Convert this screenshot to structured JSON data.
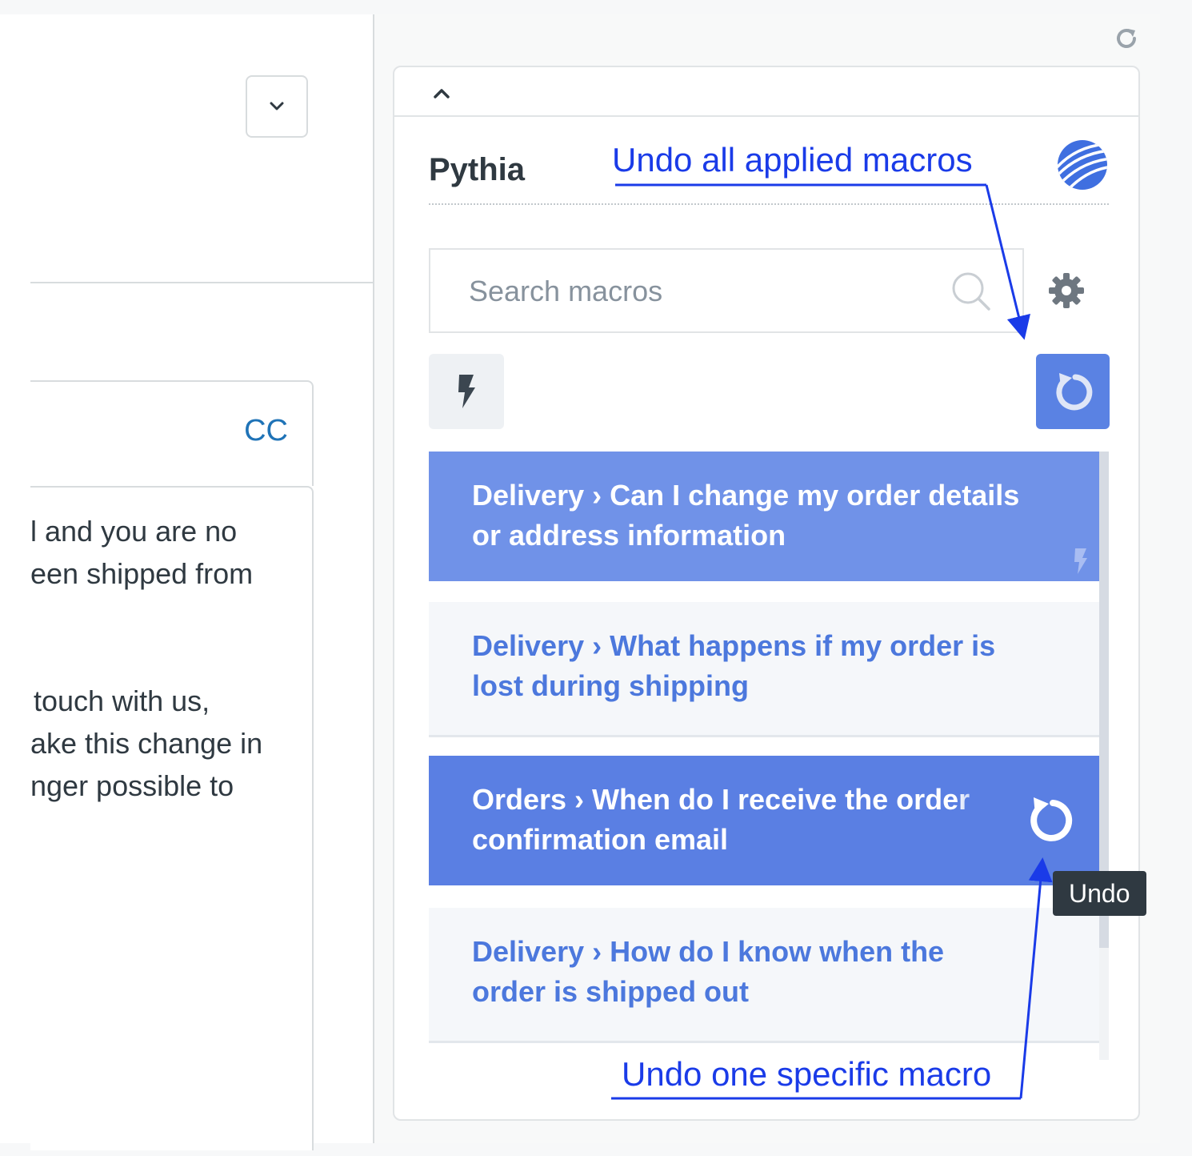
{
  "left": {
    "cc_label": "CC",
    "message_lines": [
      "l and you are no",
      "een shipped from",
      "",
      "",
      "touch with us,",
      "ake this change in",
      "nger possible to"
    ]
  },
  "panel": {
    "title": "Pythia",
    "search": {
      "placeholder": "Search macros",
      "value": ""
    },
    "macros": [
      {
        "label": "Delivery › Can I change my order details or address information",
        "state": "applied"
      },
      {
        "label": "Delivery › What happens if my order is lost during shipping",
        "state": "default"
      },
      {
        "label": "Orders › When do I receive the order confirmation email",
        "state": "hovered"
      },
      {
        "label": "Delivery › How do I know when the order is shipped out",
        "state": "default"
      }
    ],
    "tooltip": "Undo"
  },
  "annotations": {
    "undo_all": "Undo all applied macros",
    "undo_one": "Undo one specific macro"
  },
  "colors": {
    "accent": "#5a82e3",
    "annotation": "#1a3be8",
    "link": "#1f73b7"
  },
  "icons": [
    "refresh-icon",
    "chevron-down-icon",
    "chevron-up-icon",
    "logo-icon",
    "search-icon",
    "gear-icon",
    "bolt-icon",
    "undo-icon"
  ]
}
